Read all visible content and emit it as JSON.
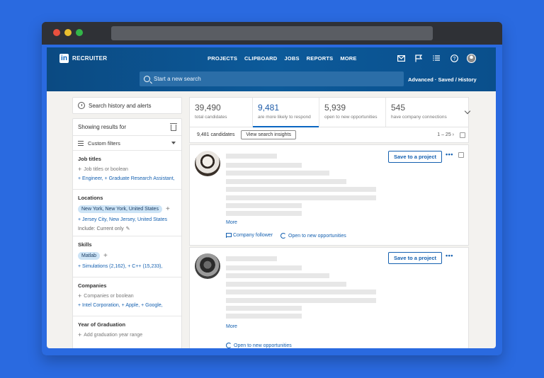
{
  "app": {
    "logo_text": "in",
    "name": "RECRUITER"
  },
  "nav": [
    "PROJECTS",
    "CLIPBOARD",
    "JOBS",
    "REPORTS",
    "MORE"
  ],
  "search": {
    "placeholder": "Start a new search",
    "advanced": "Advanced · Saved / History"
  },
  "sidebar": {
    "history_label": "Search history and alerts",
    "showing_results": "Showing results for",
    "custom_filters": "Custom filters",
    "job_titles": {
      "title": "Job titles",
      "placeholder": "Job titles or boolean",
      "suggestions": "+ Engineer,  + Graduate Research Assistant,"
    },
    "locations": {
      "title": "Locations",
      "chip": "New York, New York, United States",
      "suggestion": "+ Jersey City, New Jersey, United States",
      "include": "Include: Current only"
    },
    "skills": {
      "title": "Skills",
      "chip": "Matlab",
      "suggestions": "+ Simulations (2,162),  + C++ (15,233),"
    },
    "companies": {
      "title": "Companies",
      "placeholder": "Companies or boolean",
      "suggestions": "+ Intel Corporation,  + Apple,  + Google,"
    },
    "graduation": {
      "title": "Year of Graduation",
      "placeholder": "Add graduation year range"
    }
  },
  "stats": [
    {
      "num": "39,490",
      "label": "total candidates"
    },
    {
      "num": "9,481",
      "label": "are more likely to respond"
    },
    {
      "num": "5,939",
      "label": "open to new opportunities"
    },
    {
      "num": "545",
      "label": "have company connections"
    }
  ],
  "results": {
    "count": "9,481 candidates",
    "insights_button": "View search insights",
    "pager": "1 – 25  ›"
  },
  "cards": [
    {
      "more": "More",
      "save": "Save to a project",
      "menu": "•••",
      "tag1": "Company follower",
      "tag2": "Open to new opportunities"
    },
    {
      "more": "More",
      "save": "Save to a project",
      "menu": "•••",
      "tag1": "Open to new opportunities"
    }
  ]
}
